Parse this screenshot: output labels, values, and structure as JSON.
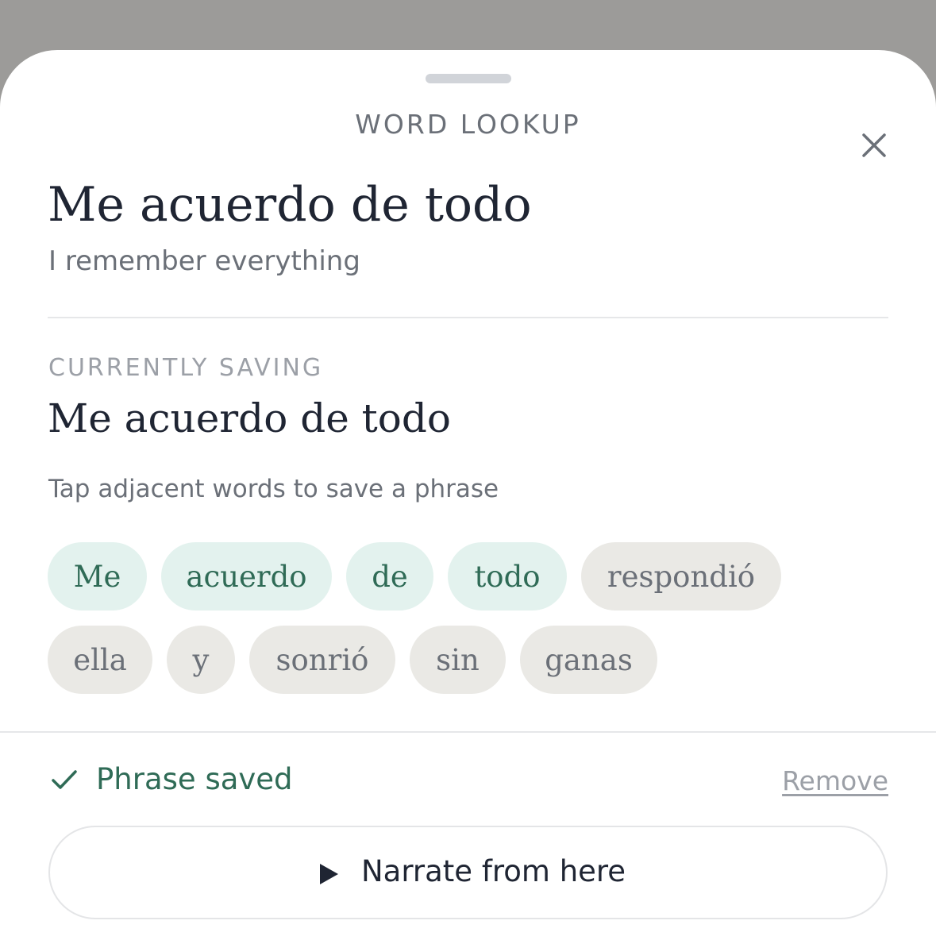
{
  "sheet": {
    "title": "WORD LOOKUP",
    "close_icon": "close-icon"
  },
  "lookup": {
    "headword": "Me acuerdo de todo",
    "translation": "I remember everything"
  },
  "saving": {
    "label": "CURRENTLY SAVING",
    "phrase": "Me acuerdo de todo",
    "hint": "Tap adjacent words to save a phrase"
  },
  "words": [
    {
      "text": "Me",
      "selected": true
    },
    {
      "text": "acuerdo",
      "selected": true
    },
    {
      "text": "de",
      "selected": true
    },
    {
      "text": "todo",
      "selected": true
    },
    {
      "text": "respondió",
      "selected": false
    },
    {
      "text": "ella",
      "selected": false
    },
    {
      "text": "y",
      "selected": false
    },
    {
      "text": "sonrió",
      "selected": false
    },
    {
      "text": "sin",
      "selected": false
    },
    {
      "text": "ganas",
      "selected": false
    }
  ],
  "status": {
    "icon": "check-icon",
    "label": "Phrase saved",
    "remove_label": "Remove"
  },
  "narrate": {
    "icon": "play-icon",
    "label": "Narrate from here"
  },
  "colors": {
    "accent_green": "#2f6b56",
    "chip_selected_bg": "#e3f2ee",
    "chip_unselected_bg": "#eae9e5",
    "backdrop": "#9c9b99"
  }
}
